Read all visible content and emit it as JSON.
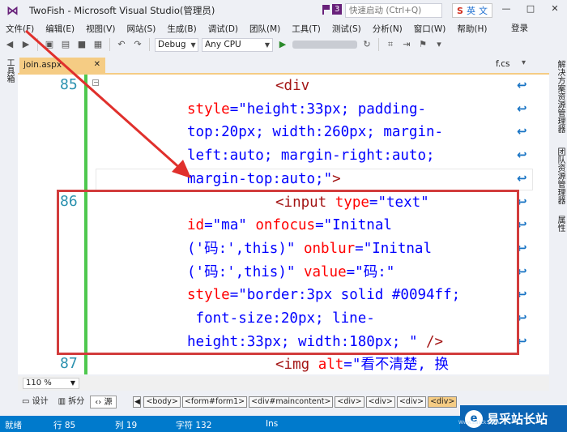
{
  "window": {
    "title": "TwoFish - Microsoft Visual Studio(管理员)",
    "notification_count": "3",
    "quick_launch_placeholder": "快速启动 (Ctrl+Q)",
    "ime": {
      "s_label": "S",
      "lang": "英",
      "extra": "文"
    },
    "controls": {
      "minimize": "—",
      "restore": "□",
      "close": "✕"
    }
  },
  "menu": {
    "items": [
      "文件(F)",
      "编辑(E)",
      "视图(V)",
      "网站(S)",
      "生成(B)",
      "调试(D)",
      "团队(M)",
      "工具(T)",
      "测试(S)",
      "分析(N)",
      "窗口(W)",
      "帮助(H)"
    ],
    "login": "登录"
  },
  "toolbar": {
    "config": "Debug",
    "platform": "Any CPU"
  },
  "side_panels": {
    "left": "工具箱",
    "right": [
      "解决方案资源管理器",
      "团队资源管理器",
      "属性"
    ]
  },
  "tabs": {
    "active": "join.aspx",
    "active_close": "✕",
    "other": "f.cs"
  },
  "code": {
    "line_numbers": [
      "85",
      "86",
      "87"
    ],
    "lines": [
      [
        {
          "t": "tag",
          "v": "<div"
        }
      ],
      [
        {
          "t": "attr",
          "v": "style"
        },
        {
          "t": "pun",
          "v": "=\""
        },
        {
          "t": "val",
          "v": "height:33px; padding-"
        }
      ],
      [
        {
          "t": "val",
          "v": "top:20px; width:260px; margin-"
        }
      ],
      [
        {
          "t": "val",
          "v": "left:auto; margin-right:auto;"
        }
      ],
      [
        {
          "t": "val",
          "v": "margin-top:auto;"
        },
        {
          "t": "pun",
          "v": "\""
        },
        {
          "t": "tag",
          "v": ">"
        }
      ],
      [
        {
          "t": "tag",
          "v": "<input "
        },
        {
          "t": "attr",
          "v": "type"
        },
        {
          "t": "pun",
          "v": "=\""
        },
        {
          "t": "val",
          "v": "text"
        },
        {
          "t": "pun",
          "v": "\""
        }
      ],
      [
        {
          "t": "attr",
          "v": "id"
        },
        {
          "t": "pun",
          "v": "=\""
        },
        {
          "t": "val",
          "v": "ma"
        },
        {
          "t": "pun",
          "v": "\" "
        },
        {
          "t": "attr",
          "v": "onfocus"
        },
        {
          "t": "pun",
          "v": "=\""
        },
        {
          "t": "val",
          "v": "Initnal"
        }
      ],
      [
        {
          "t": "val",
          "v": "('码:',this)"
        },
        {
          "t": "pun",
          "v": "\" "
        },
        {
          "t": "attr",
          "v": "onblur"
        },
        {
          "t": "pun",
          "v": "=\""
        },
        {
          "t": "val",
          "v": "Initnal"
        }
      ],
      [
        {
          "t": "val",
          "v": "('码:',this)"
        },
        {
          "t": "pun",
          "v": "\" "
        },
        {
          "t": "attr",
          "v": "value"
        },
        {
          "t": "pun",
          "v": "=\""
        },
        {
          "t": "val",
          "v": "码:"
        },
        {
          "t": "pun",
          "v": "\""
        }
      ],
      [
        {
          "t": "attr",
          "v": "style"
        },
        {
          "t": "pun",
          "v": "=\""
        },
        {
          "t": "val",
          "v": "border:3px solid #0094ff;"
        }
      ],
      [
        {
          "t": "val",
          "v": " font-size:20px; line-"
        }
      ],
      [
        {
          "t": "val",
          "v": "height:33px; width:180px; "
        },
        {
          "t": "pun",
          "v": "\" "
        },
        {
          "t": "tag",
          "v": "/>"
        }
      ],
      [
        {
          "t": "tag",
          "v": "<img "
        },
        {
          "t": "attr",
          "v": "alt"
        },
        {
          "t": "pun",
          "v": "=\""
        },
        {
          "t": "val",
          "v": "看不清楚, 换"
        }
      ]
    ]
  },
  "editor_footer": {
    "zoom": "110 %",
    "design": "设计",
    "split": "拆分",
    "source": "源",
    "breadcrumbs": [
      "<body>",
      "<form#form1>",
      "<div#maincontent>",
      "<div>",
      "<div>",
      "<div>",
      "<div>"
    ]
  },
  "status": {
    "ready": "就绪",
    "line": "行 85",
    "col": "列 19",
    "ch": "字符 132",
    "mode": "Ins"
  },
  "watermark": {
    "text": "易采站长站",
    "logo_letter": "e",
    "sub": "Www.Easck.Com"
  }
}
